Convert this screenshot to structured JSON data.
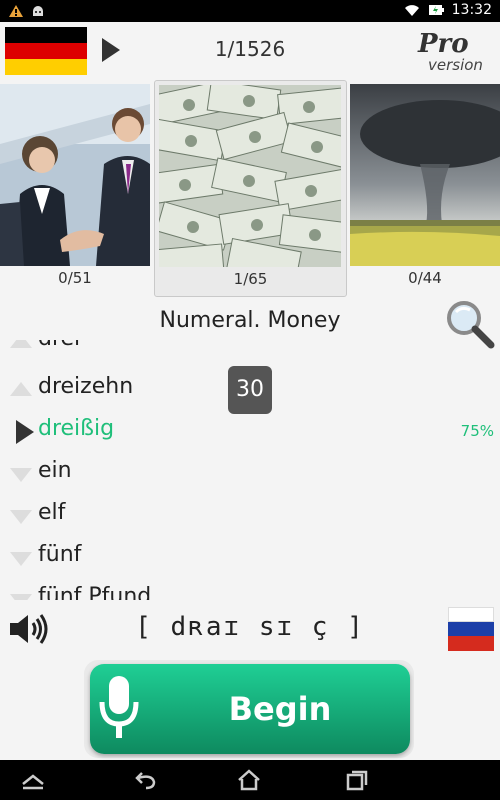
{
  "status_bar": {
    "time": "13:32",
    "icons": [
      "alert-icon",
      "android-icon",
      "wifi-icon",
      "battery-charging-icon"
    ]
  },
  "header": {
    "counter": "1/1526",
    "logo_text_top": "Pro",
    "logo_text_bottom": "version"
  },
  "categories": [
    {
      "count": "0/51",
      "image": "business-handshake"
    },
    {
      "count": "1/65",
      "image": "dollar-bills",
      "selected": true
    },
    {
      "count": "0/44",
      "image": "storm-field"
    }
  ],
  "category_title": "Numeral. Money",
  "words": [
    {
      "text": "drei",
      "marker": "none"
    },
    {
      "text": "dreizehn",
      "marker": "up"
    },
    {
      "text": "dreißig",
      "marker": "play",
      "active": true,
      "percent": "75%"
    },
    {
      "text": "ein",
      "marker": "down"
    },
    {
      "text": "elf",
      "marker": "down"
    },
    {
      "text": "fünf",
      "marker": "down"
    },
    {
      "text": "fünf Pfund",
      "marker": "down"
    }
  ],
  "badge_value": "30",
  "transcription": "[ dʀaɪ sɪ ç ]",
  "begin_label": "Begin",
  "colors": {
    "accent_green": "#1fbf7a",
    "button_top": "#1fcf95",
    "button_bottom": "#0e8a5f"
  }
}
